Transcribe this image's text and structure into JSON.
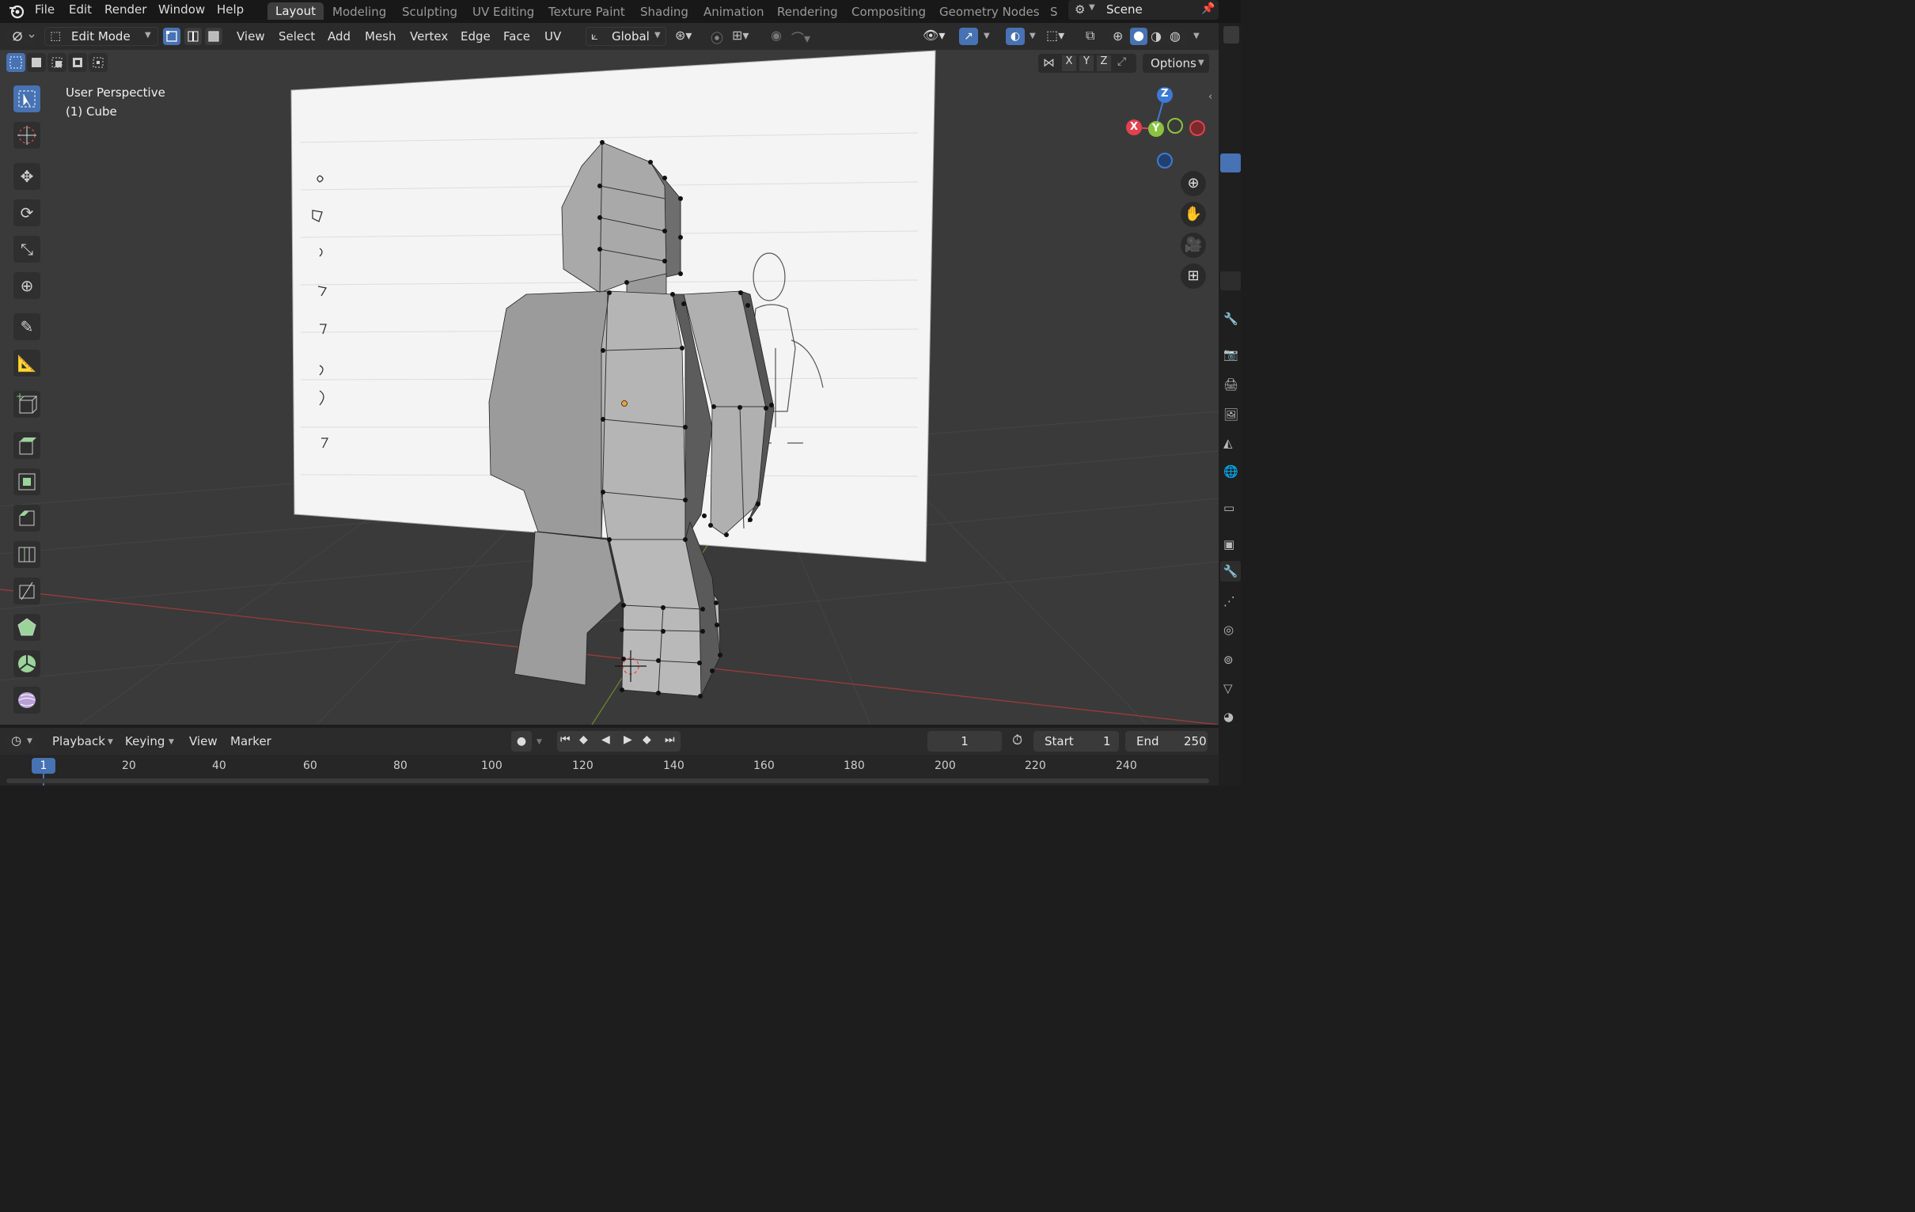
{
  "menu": {
    "file": "File",
    "edit": "Edit",
    "render": "Render",
    "window": "Window",
    "help": "Help"
  },
  "workspaces": [
    "Layout",
    "Modeling",
    "Sculpting",
    "UV Editing",
    "Texture Paint",
    "Shading",
    "Animation",
    "Rendering",
    "Compositing",
    "Geometry Nodes",
    "S"
  ],
  "active_workspace": "Layout",
  "scene": {
    "label": "Scene"
  },
  "header": {
    "mode": "Edit Mode",
    "view": "View",
    "select": "Select",
    "add": "Add",
    "mesh": "Mesh",
    "vertex": "Vertex",
    "edge": "Edge",
    "face": "Face",
    "uv": "UV",
    "orientation": "Global",
    "options": "Options",
    "axis_x": "X",
    "axis_y": "Y",
    "axis_z": "Z"
  },
  "viewport": {
    "perspective": "User Perspective",
    "object": "(1) Cube"
  },
  "gizmo": {
    "x": "X",
    "y": "Y",
    "z": "Z"
  },
  "timeline": {
    "playback": "Playback",
    "keying": "Keying",
    "view": "View",
    "marker": "Marker",
    "current_frame": "1",
    "start_label": "Start",
    "start": "1",
    "end_label": "End",
    "end": "250",
    "ruler": [
      "1",
      "20",
      "40",
      "60",
      "80",
      "100",
      "120",
      "140",
      "160",
      "180",
      "200",
      "220",
      "240"
    ]
  },
  "colors": {
    "accent": "#4772b3",
    "axis_x": "#e2414f",
    "axis_y": "#8ac33f",
    "axis_z": "#3d7ad6",
    "vertex": "#111111",
    "origin": "#f0a030"
  }
}
